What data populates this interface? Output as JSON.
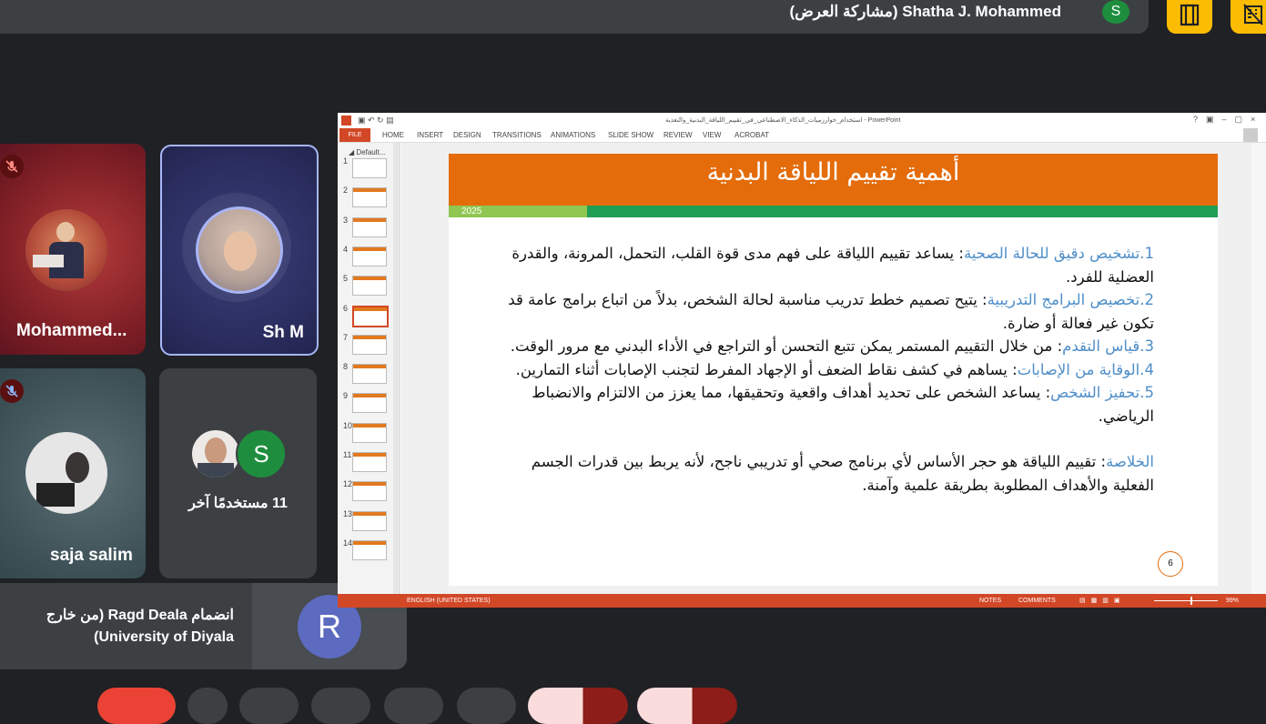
{
  "top_bar": {
    "presenter_name": "Shatha J. Mohammed",
    "presenting_label": "(مشاركة العرض)",
    "avatar_letter": "S",
    "avatar_color": "#1e8e3e",
    "button_color": "#fbbc04"
  },
  "tiles": [
    {
      "name": "Mohammed...",
      "muted": true
    },
    {
      "name": "Sh M",
      "muted": false
    },
    {
      "name": "saja salim",
      "muted": true
    },
    {
      "name": "مستخدمًا آخر",
      "count": "11",
      "avatar_letter": "S"
    }
  ],
  "notification": {
    "line1": "انضمام Ragd Deala (من خارج",
    "line2": "University of Diyala)",
    "avatar_letter": "R",
    "avatar_color": "#5c6bc0"
  },
  "powerpoint": {
    "window_title": "استخدام_خوارزميات_الذكاء_الاصطناعي_في_تقييم_اللياقة_البدنية_والتغذية - PowerPoint",
    "ribbon_tabs": [
      "FILE",
      "HOME",
      "INSERT",
      "DESIGN",
      "TRANSITIONS",
      "ANIMATIONS",
      "SLIDE SHOW",
      "REVIEW",
      "VIEW",
      "ACROBAT"
    ],
    "section_label": "Default...",
    "thumbnails": [
      "1",
      "2",
      "3",
      "4",
      "5",
      "6",
      "7",
      "8",
      "9",
      "10",
      "11",
      "12",
      "13",
      "14"
    ],
    "selected_slide": "6",
    "status_language": "ENGLISH (UNITED STATES)",
    "status_notes": "NOTES",
    "status_comments": "COMMENTS",
    "zoom": "99%",
    "accent_color": "#d24726"
  },
  "slide": {
    "title": "أهمية تقييم اللياقة البدنية",
    "year": "2025",
    "items": [
      {
        "num": "1.",
        "key": "تشخيص دقيق للحالة الصحية",
        "text": ": يساعد تقييم اللياقة على فهم مدى قوة القلب، التحمل، المرونة، والقدرة العضلية للفرد."
      },
      {
        "num": "2.",
        "key": "تخصيص البرامج التدريبية",
        "text": ": يتيح تصميم خطط تدريب مناسبة لحالة الشخص، بدلاً من اتباع برامج عامة قد تكون غير فعالة أو ضارة."
      },
      {
        "num": "3.",
        "key": "قياس التقدم",
        "text": ": من خلال التقييم المستمر يمكن تتبع التحسن أو التراجع في الأداء البدني مع مرور الوقت."
      },
      {
        "num": "4.",
        "key": "الوقاية من الإصابات",
        "text": ": يساهم في كشف نقاط الضعف أو الإجهاد المفرط لتجنب الإصابات أثناء التمارين."
      },
      {
        "num": "5.",
        "key": "تحفيز الشخص",
        "text": ": يساعد الشخص على تحديد أهداف واقعية وتحقيقها، مما يعزز من الالتزام والانضباط الرياضي."
      }
    ],
    "summary_key": "الخلاصة",
    "summary_text": ": تقييم اللياقة هو حجر الأساس لأي برنامج صحي أو تدريبي ناجح، لأنه يربط بين قدرات الجسم الفعلية والأهداف المطلوبة بطريقة علمية وآمنة.",
    "page_number": "6",
    "head_color": "#e46c0a",
    "bar_color": "#1f9e55"
  }
}
